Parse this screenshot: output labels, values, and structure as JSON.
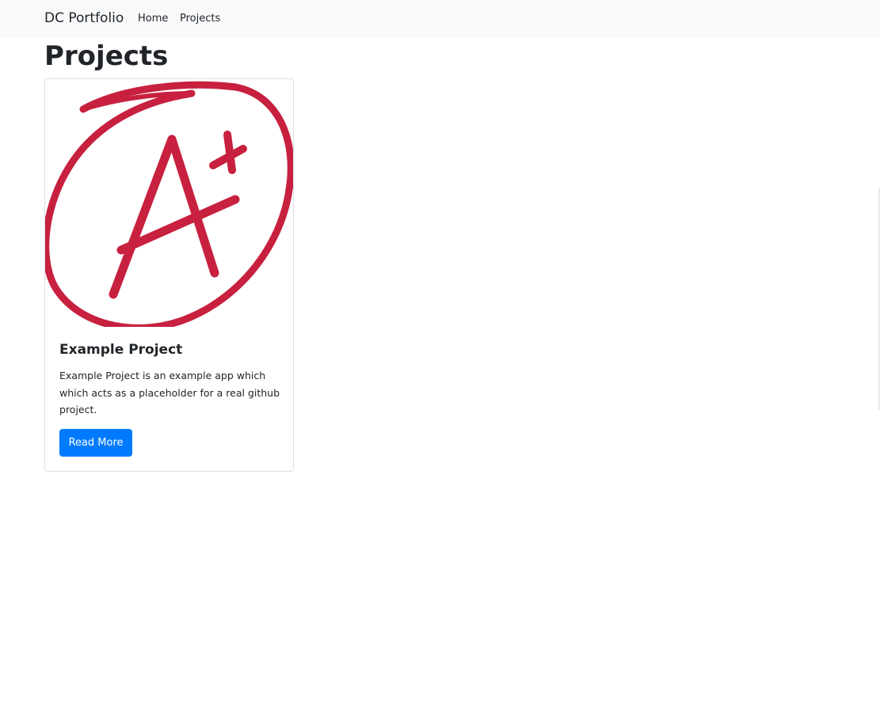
{
  "navbar": {
    "brand": "DC Portfolio",
    "links": [
      {
        "label": "Home"
      },
      {
        "label": "Projects"
      }
    ]
  },
  "page": {
    "title": "Projects"
  },
  "projects": [
    {
      "image_icon": "a-plus-grade-icon",
      "title": "Example Project",
      "description": "Example Project is an example app which which acts as a placeholder for a real github project.",
      "button_label": "Read More"
    }
  ],
  "colors": {
    "navbar_bg": "#f8f9fa",
    "primary": "#007bff",
    "grade_red": "#c8203f",
    "text": "#212529"
  }
}
